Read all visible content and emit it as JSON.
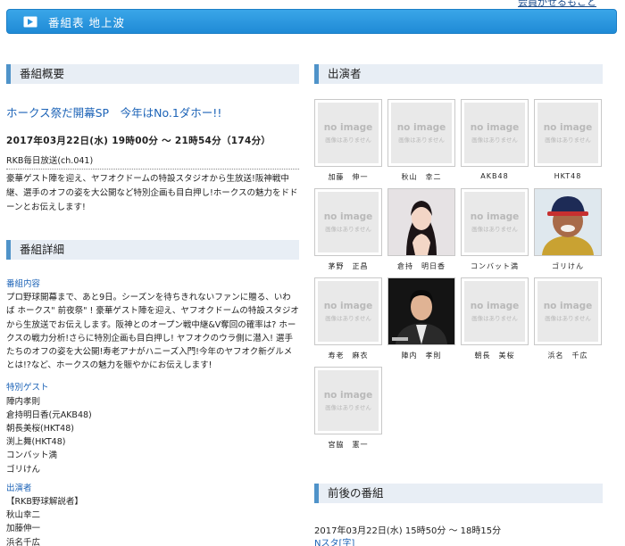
{
  "top_link": "会員がせるもこと",
  "header": {
    "title": "番組表 地上波",
    "icon": "tv-icon"
  },
  "overview": {
    "heading": "番組概要",
    "title": "ホークス祭だ開幕SP　今年はNo.1ダホー!!",
    "datetime": "2017年03月22日(水) 19時00分 ～ 21時54分（174分）",
    "channel": "RKB毎日放送(ch.041)",
    "summary": "豪華ゲスト陣を迎え、ヤフオクドームの特設スタジオから生放送!阪神戦中継、選手のオフの姿を大公開など特別企画も目白押し!ホークスの魅力をドドーンとお伝えします!"
  },
  "details": {
    "heading": "番組詳細",
    "content_label": "番組内容",
    "content": "プロ野球開幕まで、あと9日。シーズンを待ちきれないファンに贈る、いわば ホークス\" 前夜祭\" ! 豪華ゲスト陣を迎え、ヤフオクドームの特設スタジオから生放送でお伝えします。阪神とのオープン戦中継&V奪回の確率は? ホークスの戦力分析!さらに特別企画も目白押し! ヤフオクのウラ側に潜入! 選手たちのオフの姿を大公開!寿老アナがハニーズ入門!今年のヤフオク新グルメとは!?など、ホークスの魅力を賑やかにお伝えします!",
    "guests_label": "特別ゲスト",
    "guests": [
      "陣内孝則",
      "倉持明日香(元AKB48)",
      "朝長美桜(HKT48)",
      "渕上舞(HKT48)",
      "コンバット満",
      "ゴリけん"
    ],
    "cast_label": "出演者",
    "cast": [
      "【RKB野球解説者】",
      "秋山幸二",
      "加藤伸一",
      "浜名千広"
    ]
  },
  "performers": {
    "heading": "出演者",
    "noimage_big": "no image",
    "noimage_small": "画像はありません",
    "items": [
      {
        "name": "加藤　伸一",
        "photo": "none"
      },
      {
        "name": "秋山　幸二",
        "photo": "none"
      },
      {
        "name": "AKB48",
        "photo": "none"
      },
      {
        "name": "HKT48",
        "photo": "none"
      },
      {
        "name": "茅野　正昌",
        "photo": "none"
      },
      {
        "name": "倉持　明日香",
        "photo": "woman"
      },
      {
        "name": "コンバット満",
        "photo": "none"
      },
      {
        "name": "ゴリけん",
        "photo": "man-cap"
      },
      {
        "name": "寿老　麻衣",
        "photo": "none"
      },
      {
        "name": "陣内　孝則",
        "photo": "man-suit"
      },
      {
        "name": "朝長　美桜",
        "photo": "none"
      },
      {
        "name": "浜名　千広",
        "photo": "none"
      },
      {
        "name": "宮脇　憲一",
        "photo": "none"
      }
    ]
  },
  "nearby": {
    "heading": "前後の番組",
    "datetime": "2017年03月22日(水) 15時50分 ～ 18時15分",
    "link": "Nスタ[字]"
  }
}
